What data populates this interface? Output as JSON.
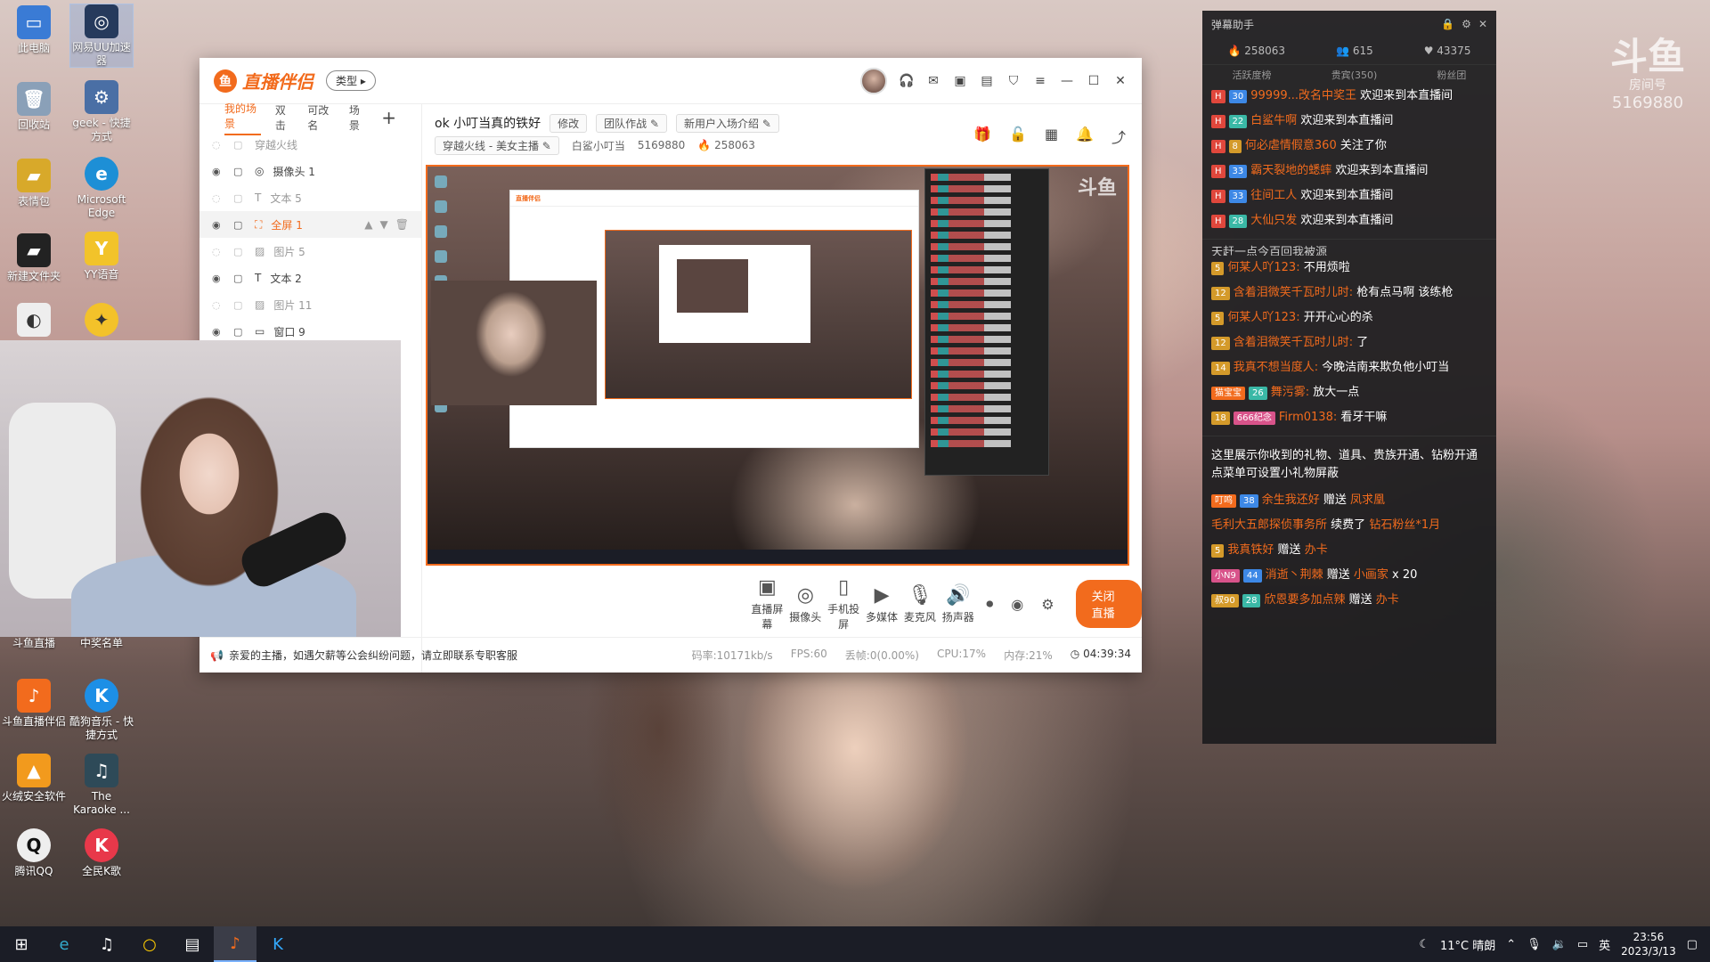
{
  "desktop": {
    "icons": [
      {
        "label": "此电脑"
      },
      {
        "label": "网易UU加速器"
      },
      {
        "label": "回收站"
      },
      {
        "label": "geek - 快捷方式"
      },
      {
        "label": "表情包"
      },
      {
        "label": "Microsoft Edge"
      },
      {
        "label": "新建文件夹"
      },
      {
        "label": "YY语音"
      },
      {
        "label": "斗鱼直播"
      },
      {
        "label": "中奖名单"
      },
      {
        "label": "斗鱼直播伴侣"
      },
      {
        "label": "酷狗音乐 - 快捷方式"
      },
      {
        "label": "火绒安全软件"
      },
      {
        "label": "The Karaoke ..."
      },
      {
        "label": "腾讯QQ"
      },
      {
        "label": "全民K歌"
      }
    ]
  },
  "window": {
    "logo_text": "直播伴侣",
    "type_pill": "类型",
    "sidebar": {
      "tabs": [
        "我的场景",
        "双击",
        "可改名",
        "场景"
      ],
      "rows": [
        {
          "label": "穿越火线"
        },
        {
          "label": "摄像头 1"
        },
        {
          "label": "文本 5"
        },
        {
          "label": "全屏 1"
        },
        {
          "label": "图片 5"
        },
        {
          "label": "文本 2"
        },
        {
          "label": "图片 11"
        },
        {
          "label": "窗口 9"
        }
      ]
    },
    "header": {
      "title": "ok 小叮当真的铁好",
      "edit": "修改",
      "team": "团队作战",
      "intro": "新用户入场介绍",
      "category": "穿越火线 - 美女主播",
      "room_label": "白鲨小叮当",
      "room_id": "5169880",
      "hot": "258063"
    },
    "controls": [
      {
        "label": "直播屏幕"
      },
      {
        "label": "摄像头"
      },
      {
        "label": "手机投屏"
      },
      {
        "label": "多媒体"
      },
      {
        "label": "麦克风"
      },
      {
        "label": "扬声器"
      }
    ],
    "live_button": "关闭直播",
    "status": {
      "notice": "亲爱的主播，如遇欠薪等公会纠纷问题，请立即联系专职客服",
      "bitrate": "码率:10171kb/s",
      "fps": "FPS:60",
      "drop": "丢帧:0(0.00%)",
      "cpu": "CPU:17%",
      "mem": "内存:21%",
      "timer": "04:39:34"
    }
  },
  "chat": {
    "title": "弹幕助手",
    "stats": {
      "hot": "258063",
      "fans": "615",
      "likes": "43375"
    },
    "tabs": [
      "活跃度榜",
      "贵宾(350)",
      "粉丝团"
    ],
    "enter_msgs": [
      {
        "lv": "30",
        "name": "99999...改名中奖王",
        "text": "欢迎来到本直播间"
      },
      {
        "lv": "22",
        "name": "白鲨牛啊",
        "text": "欢迎来到本直播间"
      },
      {
        "lv": "8",
        "name": "何必虐情假意360",
        "text": "关注了你"
      },
      {
        "lv": "33",
        "name": "霸天裂地的蟋蟀",
        "text": "欢迎来到本直播间"
      },
      {
        "lv": "33",
        "name": "往间工人",
        "text": "欢迎来到本直播间"
      },
      {
        "lv": "28",
        "name": "大仙只发",
        "text": "欢迎来到本直播间"
      }
    ],
    "partial_line": "天赶一点今百回我被源",
    "chat_msgs": [
      {
        "lv": "5",
        "name": "何某人吖123:",
        "text": "不用烦啦"
      },
      {
        "lv": "12",
        "name": "含着泪微笑千瓦时儿时:",
        "text": "枪有点马啊 该练枪"
      },
      {
        "lv": "5",
        "name": "何某人吖123:",
        "text": "开开心心的杀"
      },
      {
        "lv": "12",
        "name": "含着泪微笑千瓦时儿时:",
        "text": "了"
      },
      {
        "lv": "14",
        "name": "我真不想当度人:",
        "text": "今晚洁南来欺负他小叮当"
      },
      {
        "lv": "26",
        "name": "舞污雾:",
        "text": "放大一点",
        "badge": "猫宝宝"
      },
      {
        "lv": "18",
        "name": "Firm0138:",
        "text": "看牙干嘛",
        "badge": "666纪念"
      }
    ],
    "gift_notice": "这里展示你收到的礼物、道具、贵族开通、钻粉开通\n点菜单可设置小礼物屏蔽",
    "gift_msgs": [
      {
        "badge": "叮鸣",
        "lv": "38",
        "name": "余生我还好",
        "action": "赠送",
        "gift": "凤求凰"
      },
      {
        "name": "毛利大五郎探侦事务所",
        "action": "续费了",
        "gift": "钻石粉丝*1月"
      },
      {
        "lv": "5",
        "name": "我真铁好",
        "action": "赠送",
        "gift": "办卡"
      },
      {
        "badge": "小N9",
        "lv": "44",
        "name": "消逝丶荆棘",
        "action": "赠送",
        "gift": "小画家",
        "count": "x 20"
      },
      {
        "badge": "叔90",
        "lv": "28",
        "name": "欣恩要多加点辣",
        "action": "赠送",
        "gift": "办卡"
      }
    ]
  },
  "watermark": {
    "logo": "斗鱼",
    "sub": "房间号",
    "room": "5169880"
  },
  "taskbar": {
    "weather": "11°C 晴朗",
    "ime": "英",
    "time": "23:56",
    "date": "2023/3/13"
  }
}
